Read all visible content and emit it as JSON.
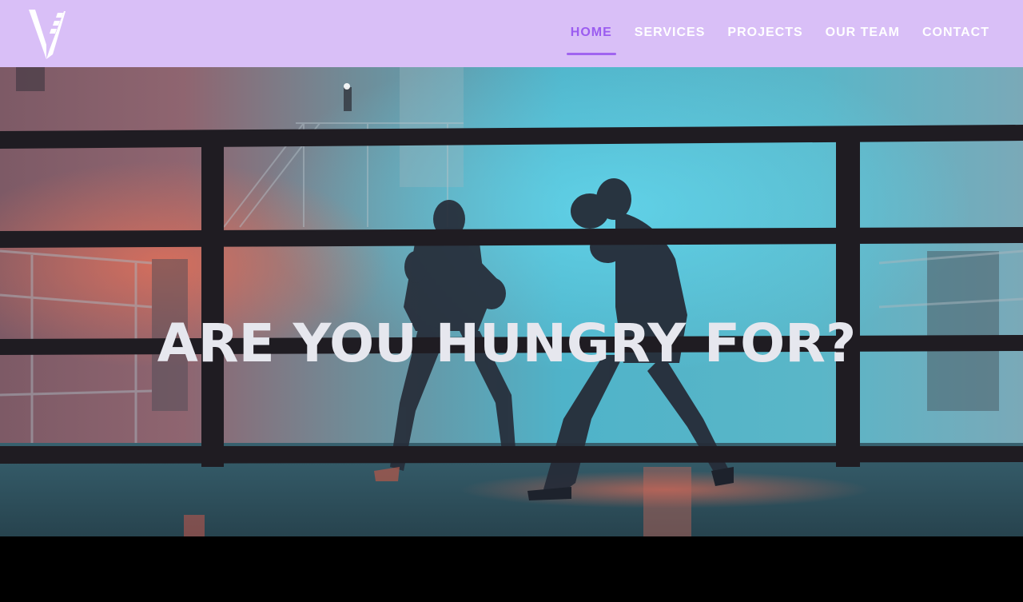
{
  "header": {
    "logo_icon": "v-logo-icon",
    "background": "#d9bff7",
    "nav": [
      {
        "label": "HOME",
        "active": true
      },
      {
        "label": "SERVICES",
        "active": false
      },
      {
        "label": "PROJECTS",
        "active": false
      },
      {
        "label": "OUR TEAM",
        "active": false
      },
      {
        "label": "CONTACT",
        "active": false
      }
    ],
    "active_color": "#9b5cf0"
  },
  "hero": {
    "headline": "ARE YOU HUNGRY FOR?",
    "image": "boxing-ring-two-fighters-image"
  }
}
